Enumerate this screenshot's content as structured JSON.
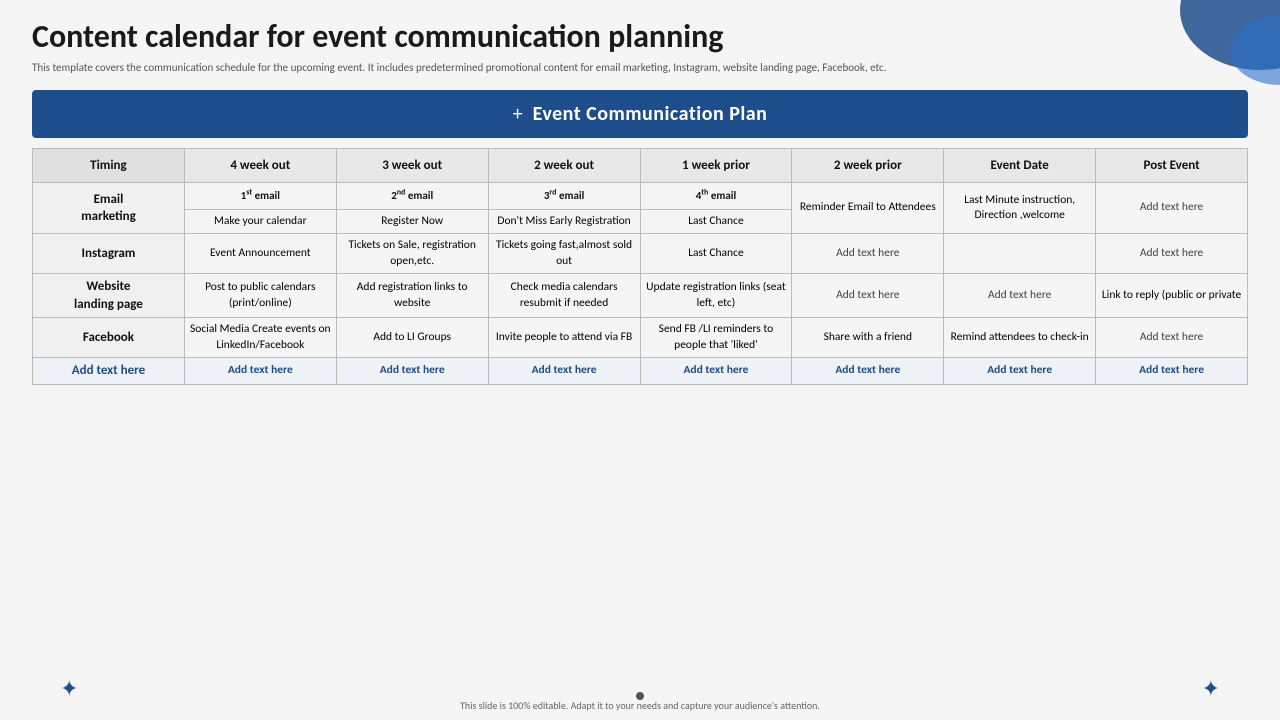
{
  "title": "Content calendar for event communication planning",
  "subtitle": "This template covers the communication schedule for the upcoming event. It includes predetermined promotional content for email marketing, Instagram, website landing page, Facebook, etc.",
  "banner": {
    "plus": "+",
    "title": "Event Communication Plan"
  },
  "table": {
    "headers": [
      "Timing",
      "4 week out",
      "3 week out",
      "2 week out",
      "1 week prior",
      "2 week prior",
      "Event Date",
      "Post Event"
    ],
    "rows": [
      {
        "label": "Email marketing",
        "cells": [
          {
            "sub": "1st email",
            "text": "Make your calendar"
          },
          {
            "sub": "2nd email",
            "text": "Register Now"
          },
          {
            "sub": "3rd email",
            "text": "Don't Miss Early Registration"
          },
          {
            "sub": "4th email",
            "text": "Last Chance"
          },
          {
            "text": "Reminder Email to Attendees"
          },
          {
            "text": "Last Minute instruction, Direction ,welcome"
          },
          {
            "text": "Add text here"
          }
        ]
      },
      {
        "label": "Instagram",
        "cells": [
          {
            "text": "Event Announcement"
          },
          {
            "text": "Tickets on Sale, registration open,etc."
          },
          {
            "text": "Tickets going fast,almost sold out"
          },
          {
            "text": "Last Chance"
          },
          {
            "text": "Add text here"
          },
          {
            "text": ""
          },
          {
            "text": "Add text here"
          }
        ]
      },
      {
        "label": "Website landing page",
        "cells": [
          {
            "text": "Post to public calendars (print/online)"
          },
          {
            "text": "Add registration links to website"
          },
          {
            "text": "Check media calendars resubmit if needed"
          },
          {
            "text": "Update registration links (seat left, etc)"
          },
          {
            "text": "Add text here"
          },
          {
            "text": "Add text here"
          },
          {
            "text": "Link to reply (public or private"
          }
        ]
      },
      {
        "label": "Facebook",
        "cells": [
          {
            "text": "Social Media Create events on LinkedIn/Facebook"
          },
          {
            "text": "Add to LI Groups"
          },
          {
            "text": "Invite people to attend via FB"
          },
          {
            "text": "Send FB /LI reminders to people that 'liked'"
          },
          {
            "text": "Share with a friend"
          },
          {
            "text": "Remind attendees to check-in"
          },
          {
            "text": "Add text here"
          }
        ]
      },
      {
        "label": "Add text here",
        "cells": [
          {
            "text": "Add text here"
          },
          {
            "text": "Add text here"
          },
          {
            "text": "Add text here"
          },
          {
            "text": "Add text here"
          },
          {
            "text": "Add text here"
          },
          {
            "text": "Add text here"
          },
          {
            "text": "Add text here"
          }
        ]
      }
    ]
  },
  "footer": "This slide is 100% editable. Adapt it to your needs and capture your audience's attention."
}
